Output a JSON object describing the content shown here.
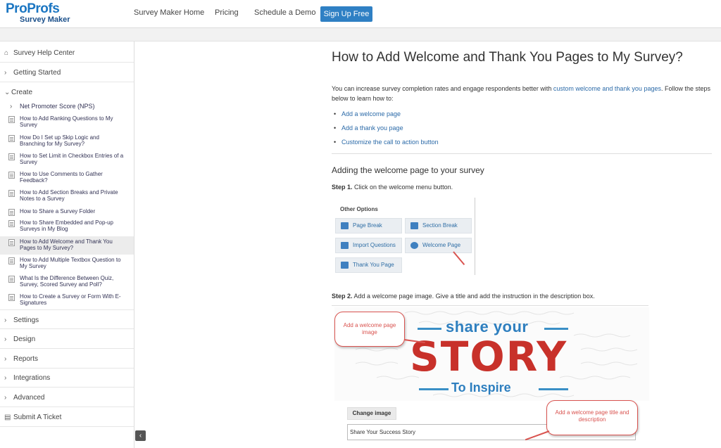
{
  "brand": {
    "line1_pro": "Pro",
    "line1_profs": "Profs",
    "line2": "Survey Maker"
  },
  "nav": {
    "items": [
      "Survey Maker Home",
      "Pricing",
      "Schedule a Demo"
    ],
    "signup": "Sign Up Free"
  },
  "sidebar": {
    "help_center": "Survey Help Center",
    "getting_started": "Getting Started",
    "create": "Create",
    "nps": "Net Promoter Score (NPS)",
    "articles": [
      "How to Add Ranking Questions to My Survey",
      "How Do I Set up Skip Logic and Branching for My Survey?",
      "How to Set Limit in Checkbox Entries of a Survey",
      "How to Use Comments to Gather Feedback?",
      "How to Add Section Breaks and Private Notes to a Survey",
      "How to Share a Survey Folder",
      "How to Share Embedded and Pop-up Surveys in My Blog",
      "How to Add Welcome and Thank You Pages to My Survey?",
      "How to Add Multiple Textbox Question to My Survey",
      "What Is the Difference Between Quiz, Survey, Scored Survey and Poll?",
      "How to Create a Survey or Form With E-Signatures"
    ],
    "sections": [
      "Settings",
      "Design",
      "Reports",
      "Integrations",
      "Advanced"
    ],
    "submit_ticket": "Submit A Ticket"
  },
  "article": {
    "title": "How to Add Welcome and Thank You Pages to My Survey?",
    "intro_before": "You can increase survey completion rates and engage respondents better with ",
    "intro_link": "custom welcome and thank you pages",
    "intro_after": ". Follow the steps below to learn how to:",
    "bullets": [
      "Add a welcome page",
      "Add a thank you page",
      "Customize the call to action button"
    ],
    "section1": "Adding the welcome page to your survey",
    "step1_label": "Step 1.",
    "step1_text": " Click on the welcome menu button.",
    "step2_label": "Step 2.",
    "step2_text": " Add a welcome page image. Give a title and add the instruction in the description box."
  },
  "other_options": {
    "title": "Other Options",
    "buttons": [
      "Page Break",
      "Section Break",
      "Import Questions",
      "Welcome Page",
      "Thank You Page"
    ]
  },
  "welcome_image": {
    "share": "share your",
    "story": "STORY",
    "inspire": "To Inspire",
    "change_button": "Change image",
    "title_value": "Share Your Success Story",
    "callout1": "Add a welcome page image",
    "callout2": "Add a welcome page title and description"
  },
  "colors": {
    "accent": "#2f80c4",
    "link": "#2b6aa8",
    "story_red": "#c8312a",
    "callout_red": "#d9534f"
  }
}
